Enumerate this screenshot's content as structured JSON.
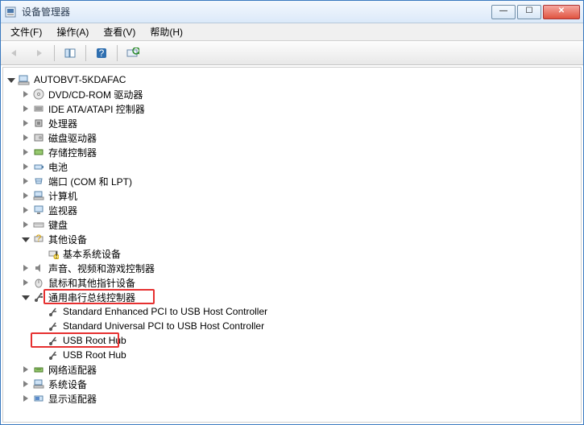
{
  "window": {
    "title": "设备管理器"
  },
  "menu": {
    "file": "文件(F)",
    "action": "操作(A)",
    "view": "查看(V)",
    "help": "帮助(H)"
  },
  "tree": {
    "root": "AUTOBVT-5KDAFAC",
    "dvd": "DVD/CD-ROM 驱动器",
    "ide": "IDE ATA/ATAPI 控制器",
    "cpu": "处理器",
    "disk": "磁盘驱动器",
    "storage": "存储控制器",
    "battery": "电池",
    "ports": "端口 (COM 和 LPT)",
    "computer": "计算机",
    "monitor": "监视器",
    "keyboard": "键盘",
    "other": "其他设备",
    "other_basic": "基本系统设备",
    "sound": "声音、视频和游戏控制器",
    "mouse": "鼠标和其他指针设备",
    "usb": "通用串行总线控制器",
    "usb_enh": "Standard Enhanced PCI to USB Host Controller",
    "usb_univ": "Standard Universal PCI to USB Host Controller",
    "usb_root1": "USB Root Hub",
    "usb_root2": "USB Root Hub",
    "net": "网络适配器",
    "system": "系统设备",
    "display": "显示适配器"
  }
}
